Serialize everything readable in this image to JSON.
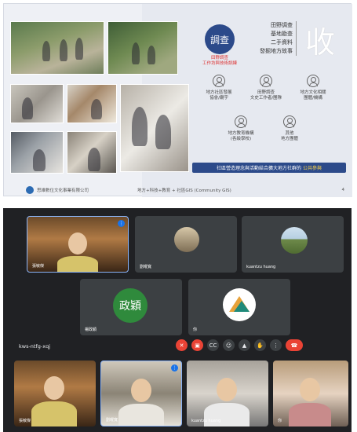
{
  "slide": {
    "circle_label": "調查",
    "circle_sub": "田野調查\n工作坊與技術訓練",
    "list": [
      "田野調查",
      "基地勘查",
      "二手資料",
      "發掘地方故事"
    ],
    "big_char": "收",
    "people": [
      {
        "label": "地方社區發展\n協會/廟宇"
      },
      {
        "label": "田野調查\n文史工作者/團隊"
      },
      {
        "label": "地方文化相關\n團體/機構"
      },
      {
        "label": "地方教育機構\n(各級學校)"
      },
      {
        "label": "其他\n地方團體"
      }
    ],
    "banner_text": "社區營造理念與活動結合擴大地方社群的",
    "banner_highlight": "公共參與",
    "footer_org": "思維數位文化事業有限公司",
    "footer_center": "地方+科技+教育 + 社區GIS (Community GIS)",
    "page_num": "4"
  },
  "meet": {
    "meeting_code": "kws-ntfg-xqj",
    "participants": [
      {
        "name": "張敏傑"
      },
      {
        "name": "劉曜寬"
      },
      {
        "name": "kuantzu huang"
      },
      {
        "name": "楊政穎"
      },
      {
        "name": "你"
      }
    ],
    "avatar_text": "政穎",
    "bottom_names": [
      "張敏傑",
      "劉曜寬",
      "kuantzu huang",
      "你"
    ],
    "colors": {
      "bg": "#202124",
      "tile": "#3c4043",
      "accent": "#1a73e8",
      "end": "#ea4335"
    }
  }
}
